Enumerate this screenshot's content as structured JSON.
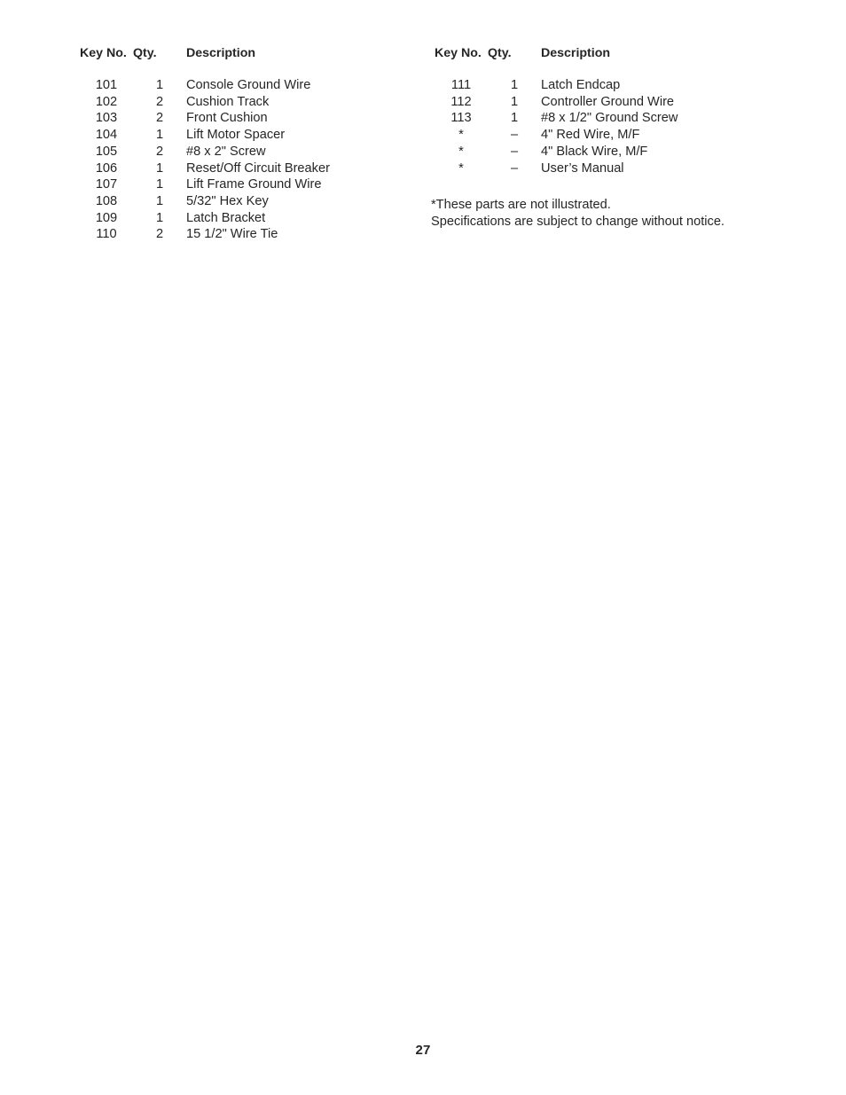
{
  "document": {
    "page_number": "27",
    "text_color": "#262626",
    "background_color": "#ffffff"
  },
  "columns": [
    {
      "headers": {
        "key_no": "Key No.",
        "qty": "Qty.",
        "description": "Description"
      },
      "rows": [
        {
          "key_no": "101",
          "qty": "1",
          "description": "Console Ground Wire"
        },
        {
          "key_no": "102",
          "qty": "2",
          "description": "Cushion Track"
        },
        {
          "key_no": "103",
          "qty": "2",
          "description": "Front Cushion"
        },
        {
          "key_no": "104",
          "qty": "1",
          "description": "Lift Motor Spacer"
        },
        {
          "key_no": "105",
          "qty": "2",
          "description": "#8 x 2\" Screw"
        },
        {
          "key_no": "106",
          "qty": "1",
          "description": "Reset/Off Circuit Breaker"
        },
        {
          "key_no": "107",
          "qty": "1",
          "description": "Lift Frame Ground Wire"
        },
        {
          "key_no": "108",
          "qty": "1",
          "description": "5/32\" Hex Key"
        },
        {
          "key_no": "109",
          "qty": "1",
          "description": "Latch Bracket"
        },
        {
          "key_no": "110",
          "qty": "2",
          "description": "15 1/2\" Wire Tie"
        }
      ]
    },
    {
      "headers": {
        "key_no": "Key No.",
        "qty": "Qty.",
        "description": "Description"
      },
      "rows": [
        {
          "key_no": "111",
          "qty": "1",
          "description": "Latch Endcap"
        },
        {
          "key_no": "112",
          "qty": "1",
          "description": "Controller Ground Wire"
        },
        {
          "key_no": "113",
          "qty": "1",
          "description": "#8 x 1/2\" Ground Screw"
        },
        {
          "key_no": "*",
          "qty": "–",
          "description": "4\" Red Wire, M/F"
        },
        {
          "key_no": "*",
          "qty": "–",
          "description": "4\" Black Wire, M/F"
        },
        {
          "key_no": "*",
          "qty": "–",
          "description": "User’s Manual"
        }
      ]
    }
  ],
  "footnotes": [
    "*These parts are not illustrated.",
    "Specifications are subject to change without notice."
  ]
}
